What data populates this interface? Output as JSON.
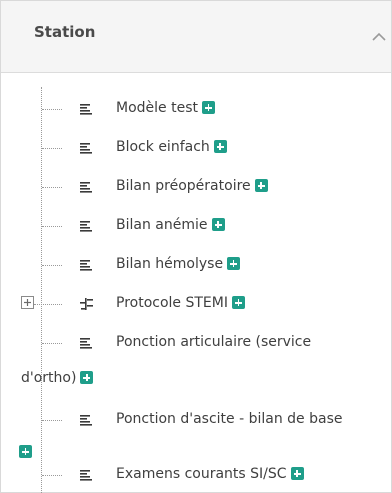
{
  "panel": {
    "title": "Station",
    "collapse_icon": "chevron-up-icon"
  },
  "tree": {
    "items": [
      {
        "label": "Modèle test",
        "icon": "document-list-icon"
      },
      {
        "label": "Block einfach",
        "icon": "document-list-icon"
      },
      {
        "label": "Bilan préopératoire",
        "icon": "document-list-icon"
      },
      {
        "label": "Bilan anémie",
        "icon": "document-list-icon"
      },
      {
        "label": "Bilan hémolyse",
        "icon": "document-list-icon"
      },
      {
        "label": "Protocole STEMI",
        "icon": "tree-structure-icon",
        "expandable": true
      },
      {
        "label": "Ponction articulaire (service",
        "label_line2": "d'ortho)",
        "icon": "document-list-icon"
      },
      {
        "label": "Ponction d'ascite - bilan de base",
        "icon": "document-list-icon"
      },
      {
        "label": "Examens courants SI/SC",
        "icon": "document-list-icon"
      }
    ]
  },
  "colors": {
    "accent": "#1f9e8a",
    "text": "#3f3f3f",
    "header_bg": "#f5f5f5"
  }
}
